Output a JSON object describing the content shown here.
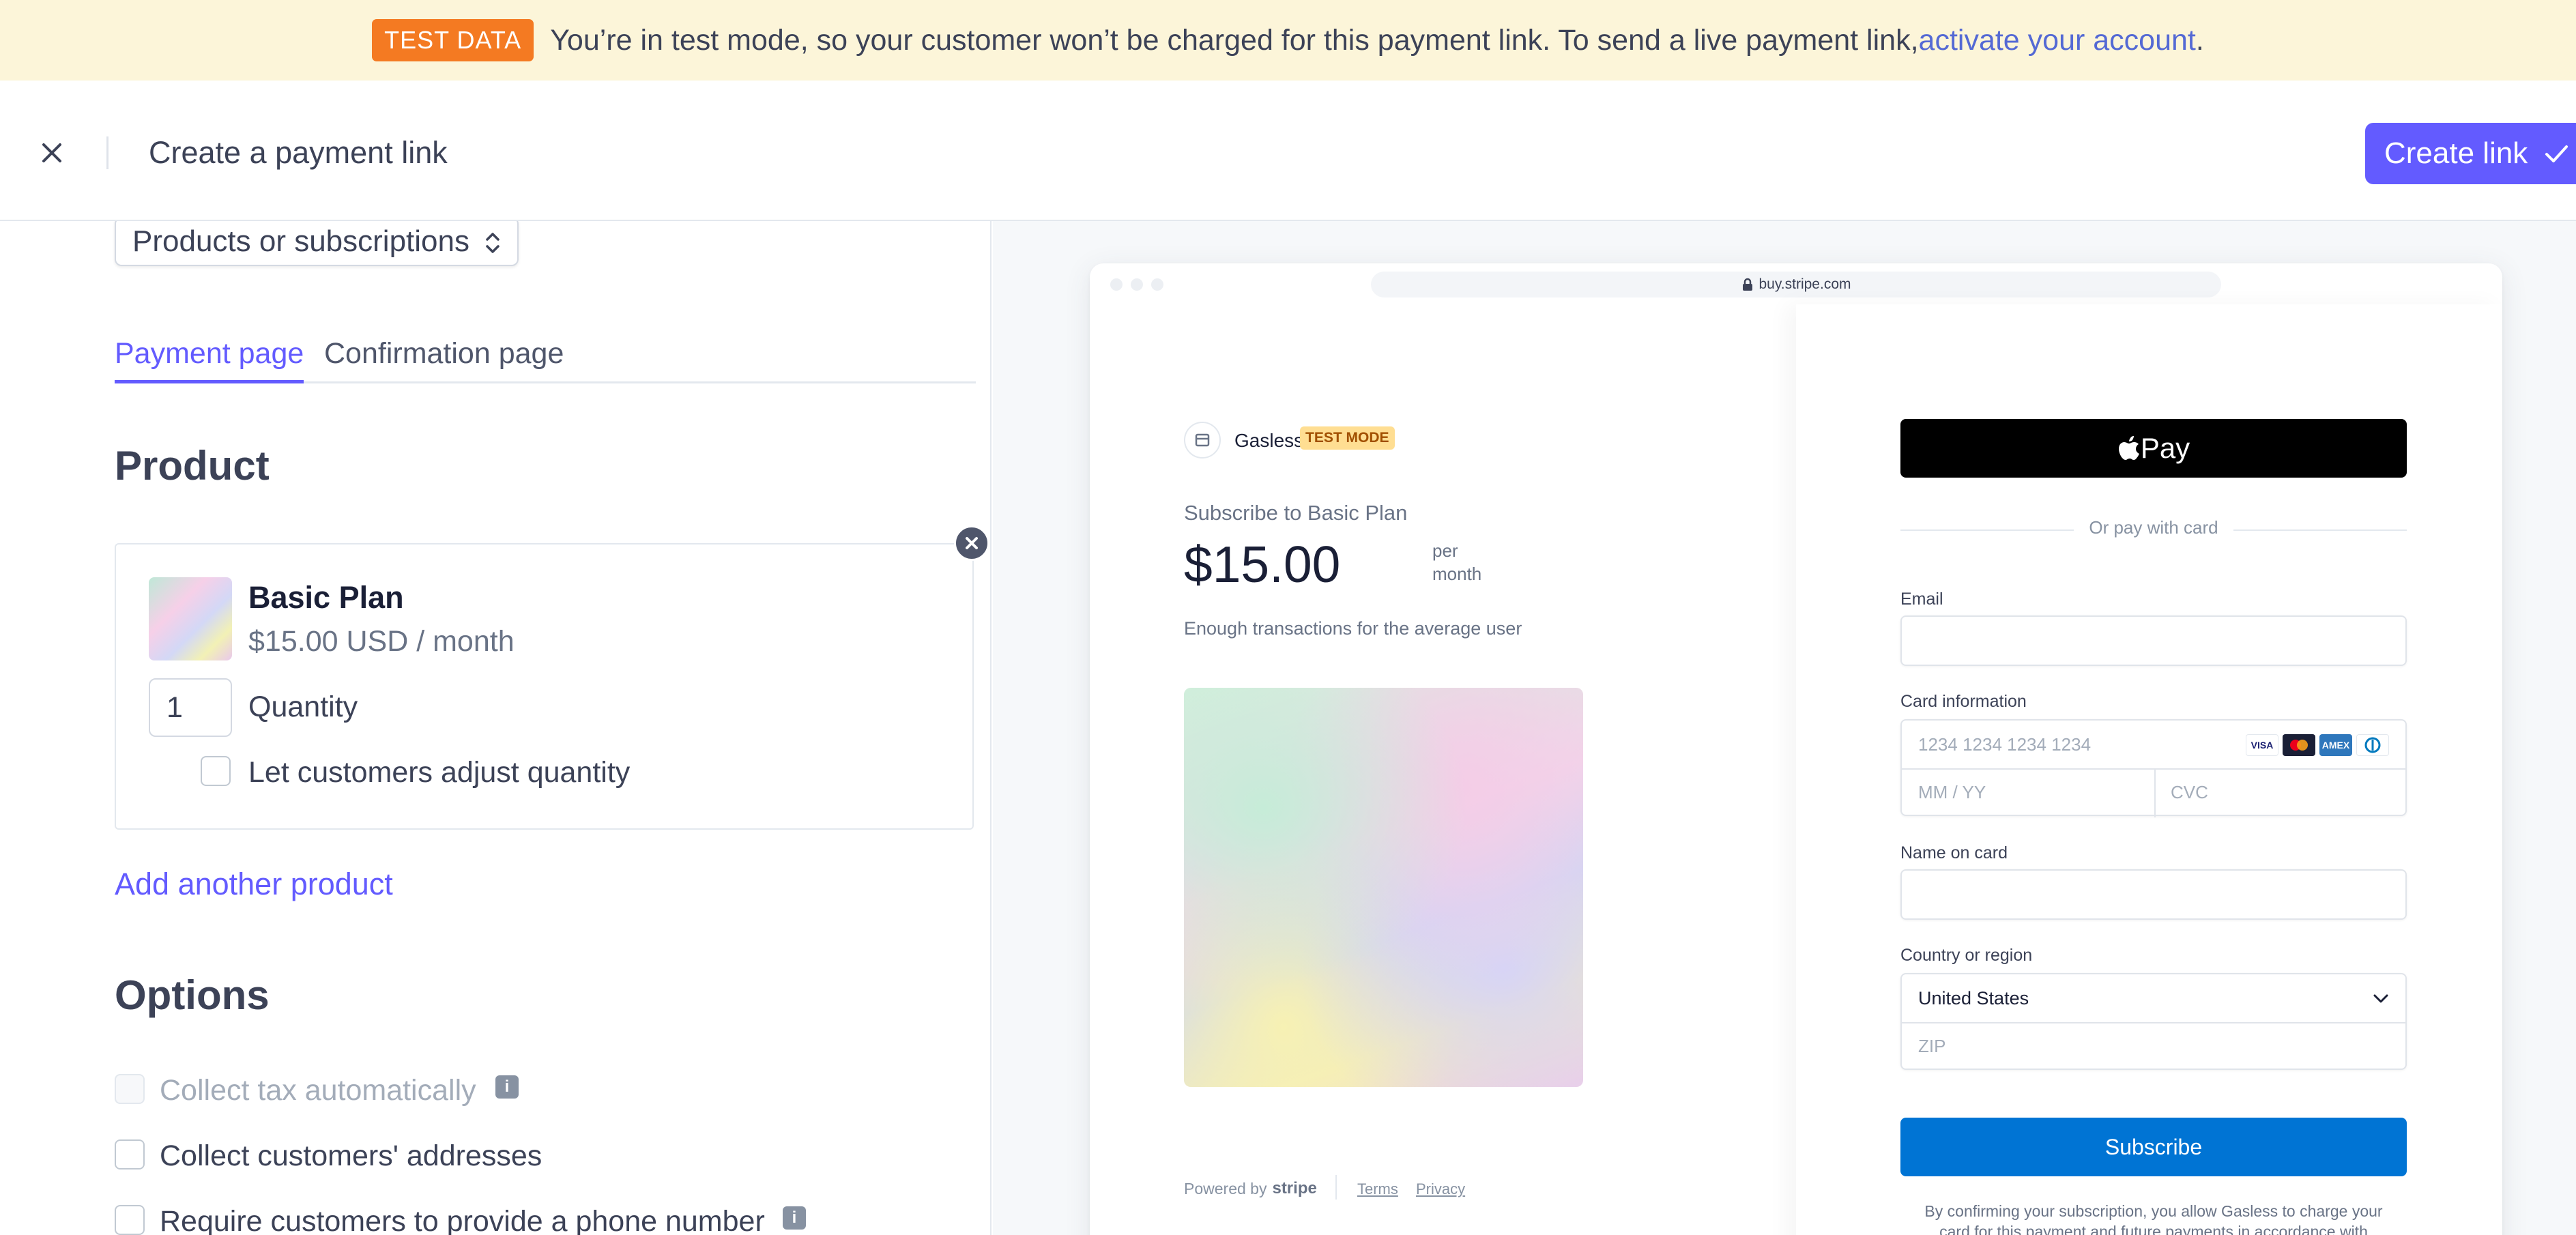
{
  "banner": {
    "badge": "TEST DATA",
    "message": "You’re in test mode, so your customer won’t be charged for this payment link. To send a live payment link, ",
    "link": "activate your account",
    "suffix": "."
  },
  "header": {
    "title": "Create a payment link",
    "create_button": "Create link"
  },
  "left": {
    "type_select": "Products or subscriptions",
    "tabs": [
      {
        "label": "Payment page",
        "active": true
      },
      {
        "label": "Confirmation page",
        "active": false
      }
    ],
    "product_heading": "Product",
    "product": {
      "name": "Basic Plan",
      "price": "$15.00 USD / month",
      "quantity": "1",
      "quantity_label": "Quantity",
      "adjust_label": "Let customers adjust quantity"
    },
    "add_product": "Add another product",
    "options_heading": "Options",
    "options": [
      {
        "label": "Collect tax automatically",
        "disabled": true
      },
      {
        "label": "Collect customers' addresses",
        "disabled": false
      },
      {
        "label": "Require customers to provide a phone number",
        "disabled": false
      }
    ]
  },
  "preview": {
    "url": "buy.stripe.com",
    "merchant": "Gasless",
    "test_badge": "TEST MODE",
    "subscribe_to": "Subscribe to Basic Plan",
    "price": "$15.00",
    "per_line1": "per",
    "per_line2": "month",
    "description": "Enough transactions for the average user",
    "powered_by": "Powered by",
    "stripe": "stripe",
    "terms": "Terms",
    "privacy": "Privacy",
    "apple_pay": "Pay",
    "or_pay": "Or pay with card",
    "email_label": "Email",
    "card_label": "Card information",
    "card_placeholder": "1234 1234 1234 1234",
    "expiry_placeholder": "MM / YY",
    "cvc_placeholder": "CVC",
    "name_label": "Name on card",
    "country_label": "Country or region",
    "country_value": "United States",
    "zip_placeholder": "ZIP",
    "subscribe_button": "Subscribe",
    "legal_line1": "By confirming your subscription, you allow Gasless to charge your",
    "legal_line2": "card for this payment and future payments in accordance with"
  },
  "colors": {
    "accent": "#635bff",
    "banner_bg": "#fcf5d9",
    "badge": "#f47a22",
    "subscribe": "#0074d4"
  }
}
